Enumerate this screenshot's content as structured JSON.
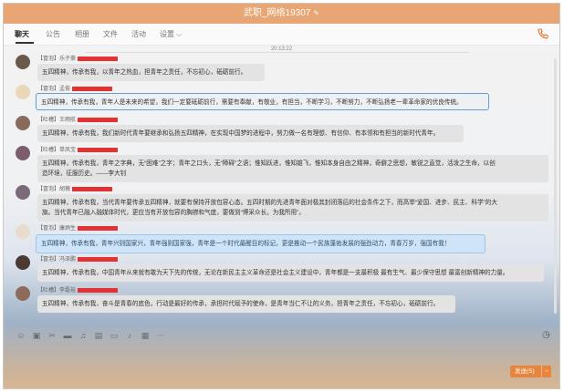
{
  "window": {
    "title": "武职_网络19307",
    "edit_icon": "edit-icon"
  },
  "tabs": [
    "聊天",
    "公告",
    "相册",
    "文件",
    "活动",
    "设置 ⌵"
  ],
  "timestamp": "20:13:22",
  "messages": [
    {
      "tag": "【冒泡】乐子豪",
      "text": "五四精神，传承有我，以青年之热血，担青年之责任，不忘初心，砥砺前行。",
      "style": "normal",
      "avatar_color": "#6b5a4a"
    },
    {
      "tag": "【冒泡】孟俊",
      "text": "五四精神，传承有我，青年人是未来的希望，我们一定要砥砺前行，需要有奉献，有敬业，有担当，不断学习，不断努力，不断弘扬老一辈革命家的优良传统。",
      "style": "selected",
      "avatar_color": "#e9d7b8"
    },
    {
      "tag": "【吐槽】王雨航",
      "text": "五四精神，传承有我，我们新时代青年要继承和弘扬五四精神，在实现中国梦的进程中，努力做一名有理想、有信仰、有本领和有担当的新时代青年。",
      "style": "normal",
      "avatar_color": "#8a6a5a"
    },
    {
      "tag": "【吐槽】单凤宝",
      "line1": "五四精神，传承有我，青年之字典，无“困难”之字；青年之口头，无“障碍”之语；惟知跃进，惟知雄飞，惟知本身自由之精神，奇僻之思想，敏锐之直觉，活泼之生命，以创",
      "line2": "造环境，征服历史。——李大钊",
      "style": "normal",
      "avatar_color": "#7a5e6e"
    },
    {
      "tag": "【冒泡】胡薇",
      "line1": "五四精神，传承有我，当代青年要传承五四精神，就要有保持开放包容心态。五四时期的先进青年面对极其封闭落后的社会条件之下，而高举“爱国、进步、民主、科学”的大",
      "line2": "旗。当代青年已融入融媒体时代，更应当有开放包容的胸襟和气度，要做到“博采众长，为我所用”。",
      "style": "normal",
      "avatar_color": "#7b6a78"
    },
    {
      "tag": "【冒泡】康炳生",
      "text": "五四精神，传承有我，青年兴则国家兴，青年强则国家强，青年是一个时代最醒目的标记，更是推动一个民族蓬勃发展的强劲动力，青春万岁，强国有我！",
      "style": "blue",
      "avatar_color": "#e8dccf"
    },
    {
      "tag": "【冒泡】冯泽鹏",
      "text": "五四精神，传承有我，中国青年从来就有敢为天下先的传统，无论在新民主主义革命还是社会主义建设中，青年都是一支最积极 最有生气、最少保守思想 最富创新精神的力量。",
      "style": "normal",
      "avatar_color": "#4a3a34"
    },
    {
      "tag": "【吐槽】李磊裕",
      "text": "五四精神，传承有我，奋斗是青春的底色，行动是最好的传承，承担时代赋予的使命，是青年当仁不让的义务，担青年之责任，不忘初心，砥砺前行。",
      "style": "normal",
      "avatar_color": "#8c6a5c"
    }
  ],
  "toolbar": {
    "icons": [
      "emoji-icon",
      "image-icon",
      "scissors-icon",
      "folder-icon",
      "music-icon",
      "document-icon",
      "card-icon",
      "mic-icon",
      "grid-icon",
      "more-icon"
    ]
  },
  "history_icon": "clock-icon",
  "send_button": {
    "label": "发送(S)",
    "caret": "⌵"
  }
}
